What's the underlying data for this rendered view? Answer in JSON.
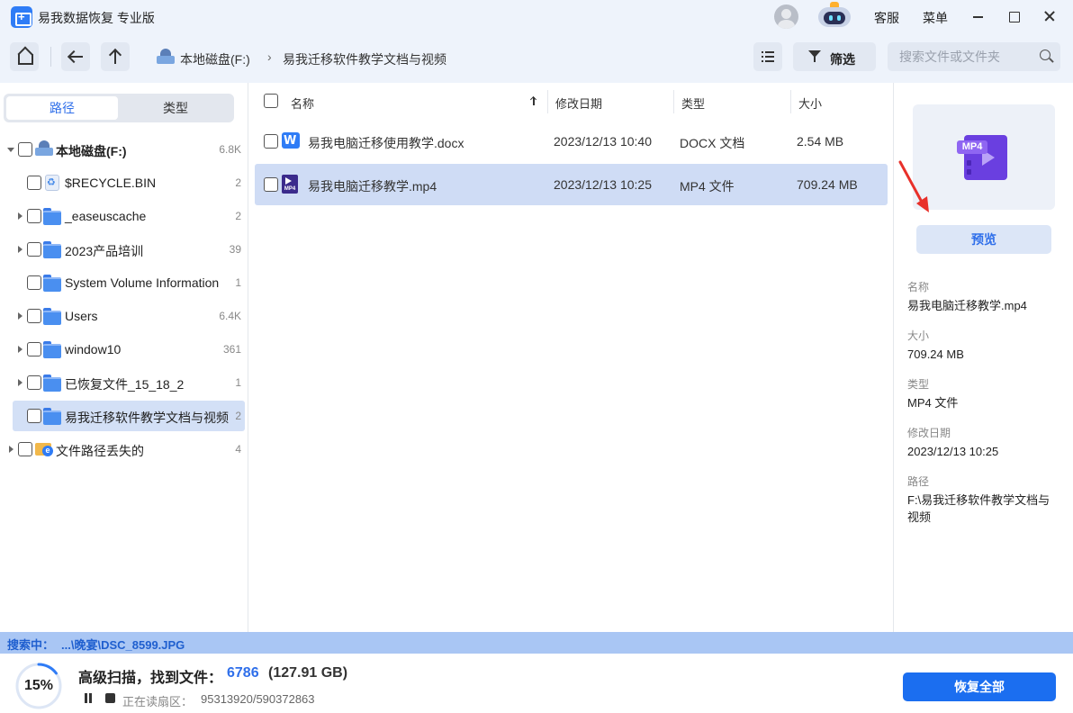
{
  "window": {
    "title": "易我数据恢复 专业版",
    "support_label": "客服",
    "menu_label": "菜单"
  },
  "toolbar": {
    "breadcrumb": [
      "本地磁盘(F:)",
      "易我迁移软件教学文档与视频"
    ],
    "filter_label": "筛选",
    "search_placeholder": "搜索文件或文件夹"
  },
  "sidebar": {
    "tabs": [
      "路径",
      "类型"
    ],
    "items": [
      {
        "label": "本地磁盘(F:)",
        "count": "6.8K"
      },
      {
        "label": "$RECYCLE.BIN",
        "count": "2"
      },
      {
        "label": "_easeuscache",
        "count": "2"
      },
      {
        "label": "2023产品培训",
        "count": "39"
      },
      {
        "label": "System Volume Information",
        "count": "1"
      },
      {
        "label": "Users",
        "count": "6.4K"
      },
      {
        "label": "window10",
        "count": "361"
      },
      {
        "label": "已恢复文件_15_18_2",
        "count": "1"
      },
      {
        "label": "易我迁移软件教学文档与视频",
        "count": "2"
      },
      {
        "label": "文件路径丢失的",
        "count": "4"
      }
    ]
  },
  "file_list": {
    "columns": [
      "名称",
      "修改日期",
      "类型",
      "大小"
    ],
    "rows": [
      {
        "name": "易我电脑迁移使用教学.docx",
        "date": "2023/12/13 10:40",
        "type": "DOCX 文档",
        "size": "2.54 MB"
      },
      {
        "name": "易我电脑迁移教学.mp4",
        "date": "2023/12/13 10:25",
        "type": "MP4 文件",
        "size": "709.24 MB"
      }
    ]
  },
  "details": {
    "thumb_tag": "MP4",
    "preview_label": "预览",
    "fields": [
      {
        "key": "名称",
        "value": "易我电脑迁移教学.mp4"
      },
      {
        "key": "大小",
        "value": "709.24 MB"
      },
      {
        "key": "类型",
        "value": "MP4 文件"
      },
      {
        "key": "修改日期",
        "value": "2023/12/13 10:25"
      },
      {
        "key": "路径",
        "value": "F:\\易我迁移软件教学文档与视频"
      }
    ]
  },
  "status": {
    "searching_label": "搜索中：",
    "searching_path": "...\\晚宴\\DSC_8599.JPG",
    "progress": 0.15,
    "progress_text": "15%",
    "scan_title": "高级扫描，找到文件：",
    "found_count": "6786",
    "found_size": "(127.91 GB)",
    "sector_label": "正在读扇区：",
    "sector_value": "95313920/590372863",
    "recover_all_label": "恢复全部"
  },
  "colors": {
    "accent": "#2f6fea",
    "primary_button": "#1b6ef0",
    "selection": "#cfdcf5",
    "scan_bar": "#a9c6f4"
  }
}
